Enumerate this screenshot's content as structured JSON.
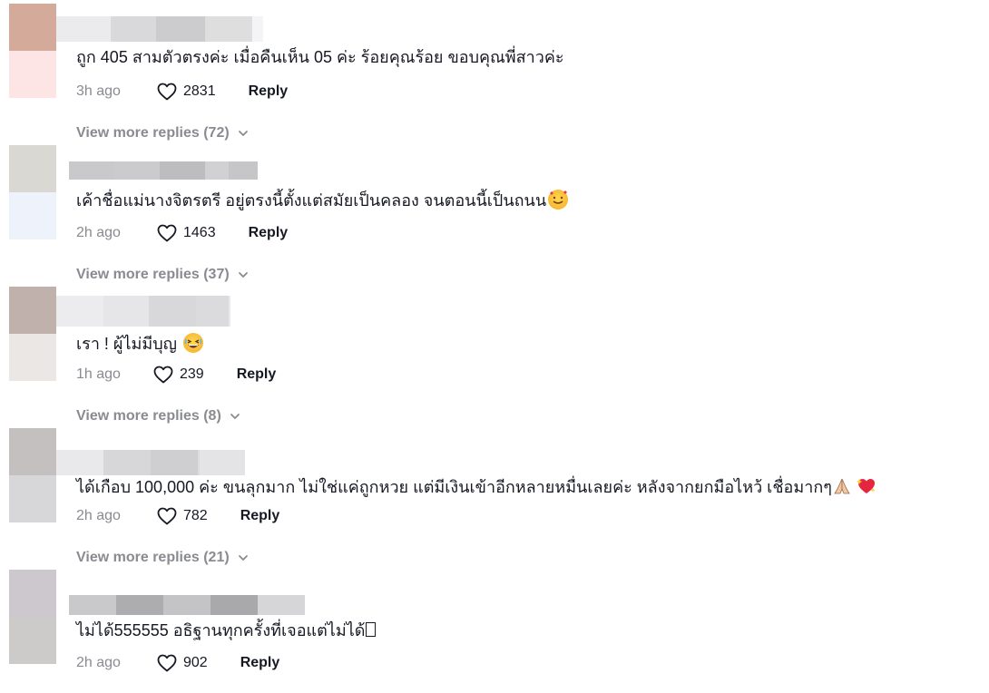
{
  "comments": [
    {
      "text": "ถูก 405 สามตัวตรงค่ะ เมื่อคืนเห็น 05 ค่ะ ร้อยคุณร้อย ขอบคุณพี่สาวค่ะ",
      "time": "3h ago",
      "likes": "2831",
      "reply_label": "Reply",
      "more_label": "View more replies (72)",
      "avatar_colors": [
        "#d4ab9a",
        "#fde5e5"
      ],
      "username_colors": [
        "#ebebed",
        "#d9d9db",
        "#ccccce",
        "#dedede",
        "#f4f4f6"
      ]
    },
    {
      "text": "เค้าชื่อแม่นางจิตรตรี อยู่ตรงนี้ตั้งแต่สมัยเป็นคลอง จนตอนนี้เป็นถนน",
      "time": "2h ago",
      "likes": "1463",
      "reply_label": "Reply",
      "more_label": "View more replies (37)",
      "avatar_colors": [
        "#dad8d3",
        "#eef3fb"
      ],
      "username_colors": [
        "#c9c9cb",
        "#cbcbcd",
        "#bdbdbf",
        "#d1d1d3",
        "#c6c6c8"
      ]
    },
    {
      "text": "เรา ! ผู้ไม่มีบุญ",
      "time": "1h ago",
      "likes": "239",
      "reply_label": "Reply",
      "more_label": "View more replies (8)",
      "avatar_colors": [
        "#c0b1ac",
        "#ebe7e5"
      ],
      "username_colors": [
        "#ececee",
        "#e6e6e8",
        "#d8d8da",
        "#dbdbdd",
        "#eaeaec"
      ]
    },
    {
      "text": "ได้เกือบ 100,000 ค่ะ ขนลุกมาก ไม่ใช่แค่ถูกหวย แต่มีเงินเข้าอีกหลายหมื่นเลยค่ะ หลังจากยกมือไหว้ เชื่อมากๆ",
      "time": "2h ago",
      "likes": "782",
      "reply_label": "Reply",
      "more_label": "View more replies (21)",
      "avatar_colors": [
        "#c3c0bf",
        "#d7d6d8"
      ],
      "username_colors": [
        "#e9e9eb",
        "#d7d7d9",
        "#cfcfd1",
        "#dcdcde",
        "#e4e4e6"
      ]
    },
    {
      "text": "ไม่ได้555555 อธิฐานทุกครั้งที่เจอแต่ไม่ได้",
      "time": "2h ago",
      "likes": "902",
      "reply_label": "Reply",
      "avatar_colors": [
        "#cdc8cd",
        "#cdcbc9"
      ],
      "username_colors": [
        "#c9c9cb",
        "#adadaf",
        "#c4c4c6",
        "#a9a9ab",
        "#d6d6d8"
      ]
    }
  ]
}
